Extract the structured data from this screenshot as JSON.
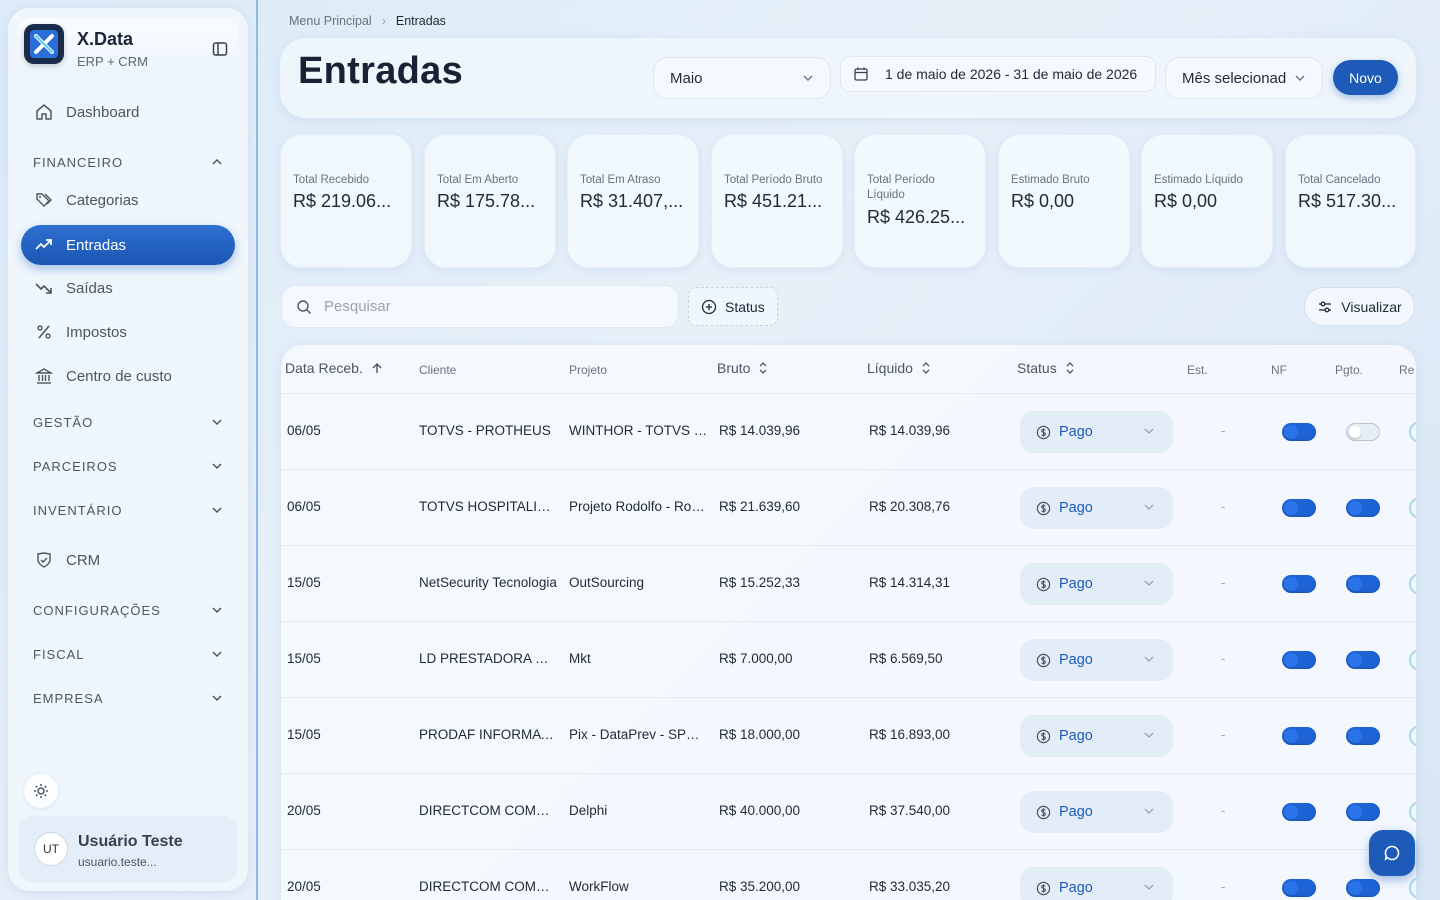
{
  "app": {
    "name": "X.Data",
    "subtitle": "ERP + CRM"
  },
  "sidebar": {
    "items": [
      {
        "label": "Dashboard",
        "icon": "home-icon"
      },
      {
        "label": "Categorias",
        "icon": "tags-icon"
      },
      {
        "label": "Entradas",
        "icon": "trending-up-icon",
        "active": true
      },
      {
        "label": "Saídas",
        "icon": "trending-down-icon"
      },
      {
        "label": "Impostos",
        "icon": "percent-icon"
      },
      {
        "label": "Centro de custo",
        "icon": "landmark-icon"
      },
      {
        "label": "CRM",
        "icon": "handshake-icon"
      }
    ],
    "sections": {
      "financeiro": "FINANCEIRO",
      "gestao": "GESTÃO",
      "parceiros": "PARCEIROS",
      "inventario": "INVENTÁRIO",
      "configuracoes": "CONFIGURAÇÕES",
      "fiscal": "FISCAL",
      "empresa": "EMPRESA"
    }
  },
  "user": {
    "initials": "UT",
    "name": "Usuário Teste",
    "email": "usuario.teste..."
  },
  "breadcrumb": {
    "root": "Menu Principal",
    "current": "Entradas"
  },
  "header": {
    "title": "Entradas",
    "month": "Maio",
    "date_range": "1 de maio de 2026 - 31 de maio de 2026",
    "period": "Mês selecionad",
    "new_button": "Novo"
  },
  "cards": [
    {
      "label": "Total Recebido",
      "value": "R$ 219.06..."
    },
    {
      "label": "Total Em Aberto",
      "value": "R$ 175.78..."
    },
    {
      "label": "Total Em Atraso",
      "value": "R$ 31.407,..."
    },
    {
      "label": "Total Período Bruto",
      "value": "R$ 451.21..."
    },
    {
      "label": "Total Período Líquido",
      "value": "R$ 426.25..."
    },
    {
      "label": "Estimado Bruto",
      "value": "R$ 0,00"
    },
    {
      "label": "Estimado Líquido",
      "value": "R$ 0,00"
    },
    {
      "label": "Total Cancelado",
      "value": "R$ 517.30..."
    }
  ],
  "filters": {
    "search_placeholder": "Pesquisar",
    "status_label": "Status",
    "view_label": "Visualizar"
  },
  "table": {
    "columns": {
      "data": "Data Receb.",
      "cliente": "Cliente",
      "projeto": "Projeto",
      "bruto": "Bruto",
      "liquido": "Líquido",
      "status": "Status",
      "est": "Est.",
      "nf": "NF",
      "pgto": "Pgto.",
      "re": "Re"
    },
    "rows": [
      {
        "data": "06/05",
        "cliente": "TOTVS - PROTHEUS",
        "projeto": "WINTHOR - TOTVS - ...",
        "bruto": "R$ 14.039,96",
        "liquido": "R$ 14.039,96",
        "status": "Pago",
        "est": "-",
        "nf": true,
        "pgto": false
      },
      {
        "data": "06/05",
        "cliente": "TOTVS HOSPITALITY...",
        "projeto": "Projeto Rodolfo - Rod...",
        "bruto": "R$ 21.639,60",
        "liquido": "R$ 20.308,76",
        "status": "Pago",
        "est": "-",
        "nf": true,
        "pgto": true
      },
      {
        "data": "15/05",
        "cliente": "NetSecurity Tecnologia",
        "projeto": "OutSourcing",
        "bruto": "R$ 15.252,33",
        "liquido": "R$ 14.314,31",
        "status": "Pago",
        "est": "-",
        "nf": true,
        "pgto": true
      },
      {
        "data": "15/05",
        "cliente": "LD PRESTADORA DE...",
        "projeto": "Mkt",
        "bruto": "R$ 7.000,00",
        "liquido": "R$ 6.569,50",
        "status": "Pago",
        "est": "-",
        "nf": true,
        "pgto": true
      },
      {
        "data": "15/05",
        "cliente": "PRODAF INFORMATI...",
        "projeto": "Pix - DataPrev - SPC ...",
        "bruto": "R$ 18.000,00",
        "liquido": "R$ 16.893,00",
        "status": "Pago",
        "est": "-",
        "nf": true,
        "pgto": true
      },
      {
        "data": "20/05",
        "cliente": "DIRECTCOM COMER...",
        "projeto": "Delphi",
        "bruto": "R$ 40.000,00",
        "liquido": "R$ 37.540,00",
        "status": "Pago",
        "est": "-",
        "nf": true,
        "pgto": true
      },
      {
        "data": "20/05",
        "cliente": "DIRECTCOM COMER...",
        "projeto": "WorkFlow",
        "bruto": "R$ 35.200,00",
        "liquido": "R$ 33.035,20",
        "status": "Pago",
        "est": "-",
        "nf": true,
        "pgto": true
      }
    ]
  },
  "colors": {
    "accent": "#1e5bb8",
    "toggle_on": "#1e63d6",
    "status_text": "#1e5bb8"
  }
}
